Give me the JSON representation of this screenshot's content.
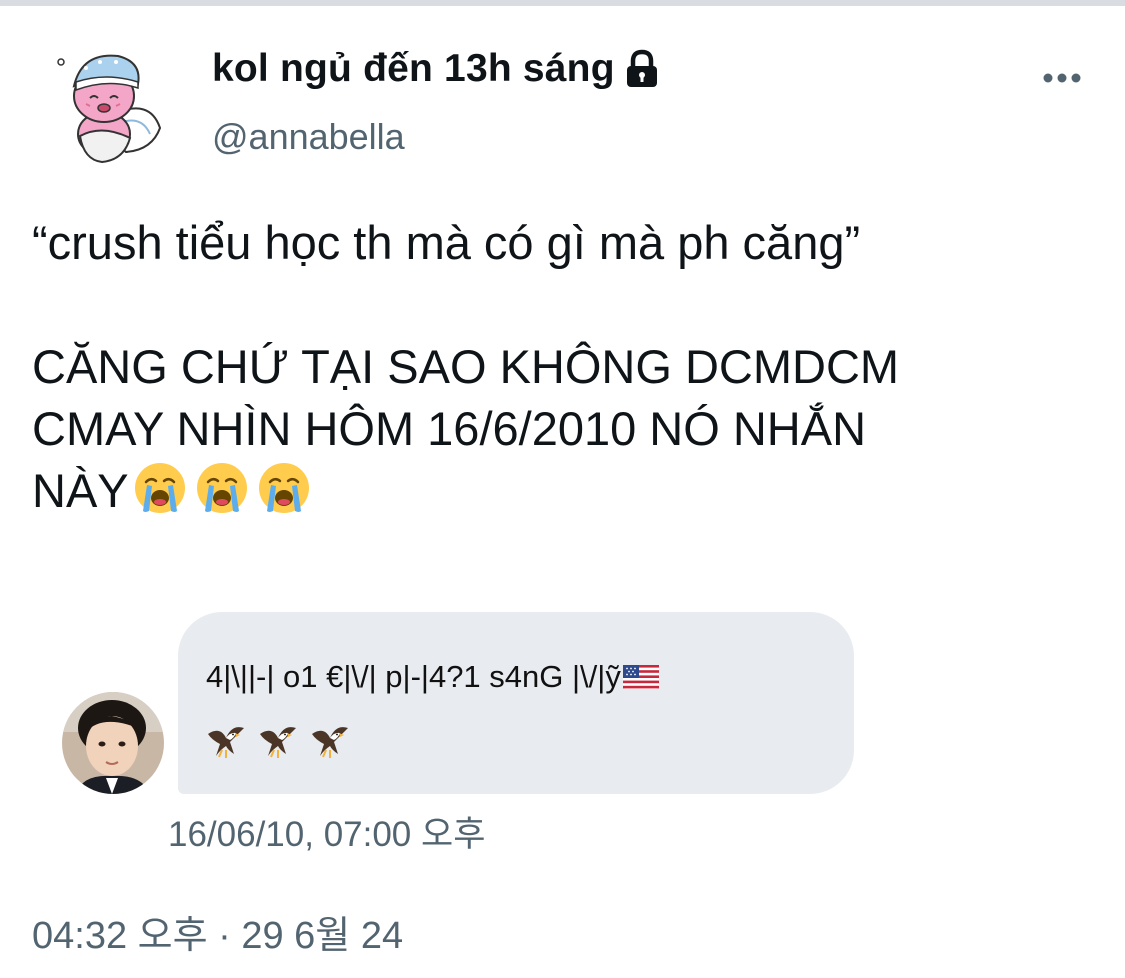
{
  "author": {
    "display_name": "kol ngủ đến 13h sáng",
    "handle": "@annabella",
    "avatar_icon": "pink-sleepy-character-avatar",
    "lock_icon": "lock-icon"
  },
  "tweet": {
    "quote_line": "“crush tiểu học th mà có gì mà ph căng”",
    "line_1": "CĂNG CHỨ TẠI SAO KHÔNG DCMDCM",
    "line_2": "CMAY NHÌN HÔM 16/6/2010 NÓ NHẮN",
    "line_3": "NÀY",
    "emoji": "loudly-crying-face",
    "emoji_count": 3,
    "timestamp": "04:32 오후 · 29 6월 24"
  },
  "embedded_message": {
    "avatar_icon": "boy-photo-avatar",
    "text": "4|\\||-| o1 €|\\/| p|-|4?1 s4nG |\\/|ỹ",
    "flag_icon": "us-flag-icon",
    "eagle_icon": "eagle-icon",
    "eagle_count": 3,
    "bubble_color": "#e8ebef",
    "timestamp": "16/06/10, 07:00 오후"
  },
  "colors": {
    "text_primary": "#0f1419",
    "text_secondary": "#536471",
    "divider": "#d9dde1"
  }
}
